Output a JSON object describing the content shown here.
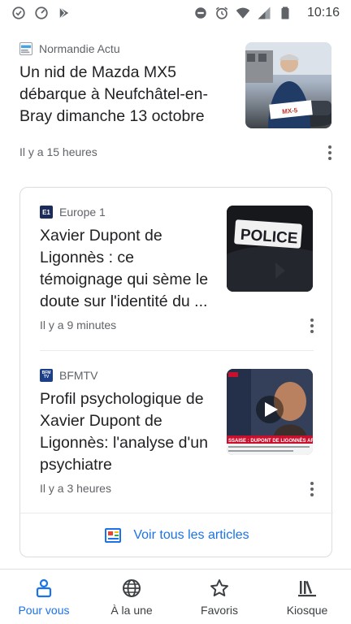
{
  "status_bar": {
    "time": "10:16",
    "left_icons": [
      "sync-icon",
      "speedometer-icon",
      "play-store-icon"
    ],
    "right_icons": [
      "do-not-disturb-icon",
      "alarm-icon",
      "wifi-icon",
      "signal-icon",
      "battery-icon"
    ]
  },
  "top_story": {
    "source": "Normandie Actu",
    "logo_text": "actu",
    "headline": "Un nid de Mazda MX5 débarque à Neufchâtel-en-Bray dimanche 13 octobre",
    "time": "Il y a 15 heures",
    "sticker_text": "MX-5"
  },
  "story_group": {
    "stories": [
      {
        "source": "Europe 1",
        "logo_text": "E1",
        "headline": "Xavier Dupont de Ligonnès : ce témoignage qui sème le doute sur l'identité du ...",
        "time": "Il y a 9 minutes",
        "image_text": "POLICE"
      },
      {
        "source": "BFMTV",
        "logo_text": "BFM TV",
        "headline": "Profil psychologique de Xavier Dupont de Ligonnès: l'analyse d'un psychiatre",
        "time": "Il y a 3 heures",
        "ticker_text": "SSAISE : DUPONT DE LIGONNÈS ARRÊTÉ"
      }
    ],
    "view_all_label": "Voir tous les articles"
  },
  "bottom_nav": {
    "items": [
      {
        "label": "Pour vous",
        "icon": "for-you-icon",
        "active": true
      },
      {
        "label": "À la une",
        "icon": "globe-icon",
        "active": false
      },
      {
        "label": "Favoris",
        "icon": "star-icon",
        "active": false
      },
      {
        "label": "Kiosque",
        "icon": "newsstand-icon",
        "active": false
      }
    ]
  },
  "colors": {
    "accent": "#1a73e8",
    "text_primary": "#202124",
    "text_secondary": "#5f6368",
    "divider": "#dadce0"
  }
}
